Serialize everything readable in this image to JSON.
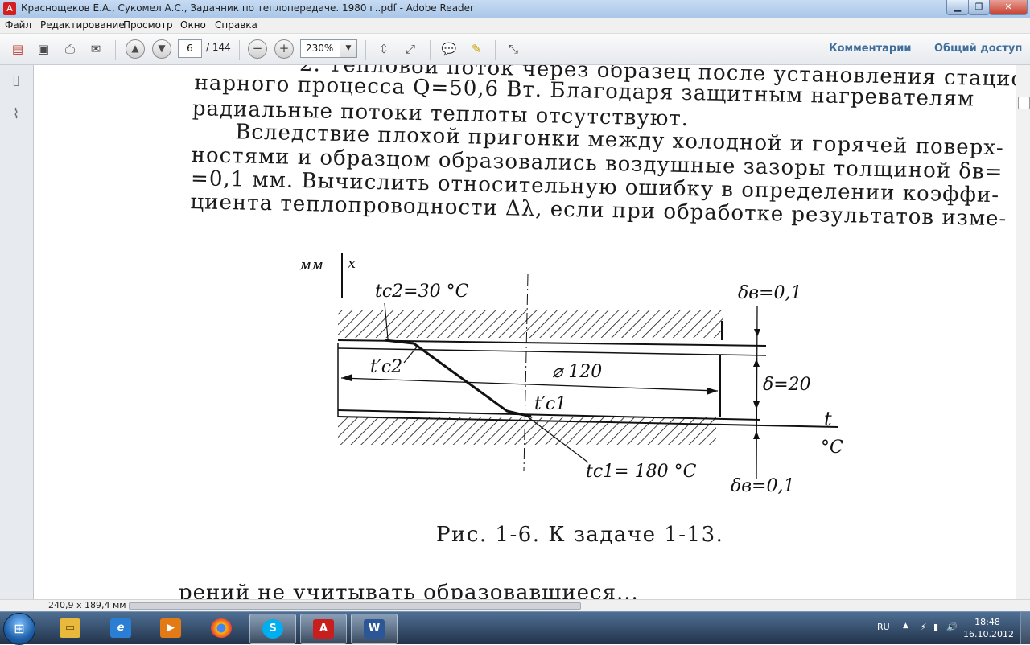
{
  "window": {
    "title": "Краснощеков Е.А., Сукомел А.С., Задачник по теплопередаче. 1980 г..pdf - Adobe Reader"
  },
  "menu": [
    "Файл",
    "Редактирование",
    "Просмотр",
    "Окно",
    "Справка"
  ],
  "toolbar": {
    "page_current": "6",
    "page_total": "/ 144",
    "zoom": "230%",
    "comments": "Комментарии",
    "share": "Общий доступ"
  },
  "document": {
    "lines": [
      "2. Тепловой поток через образец после установления стацио-",
      "нарного процесса Q=50,6 Вт. Благодаря защитным нагревателям",
      "радиальные потоки теплоты отсутствуют.",
      "Вследствие плохой пригонки между холодной и горячей поверх-",
      "ностями и образцом образовались воздушные зазоры толщиной δв=",
      "=0,1 мм. Вычислить относительную ошибку в определении коэффи-",
      "циента теплопроводности Δλ, если при обработке результатов изме-"
    ],
    "figure": {
      "axis_unit": "мм",
      "axis_x": "x",
      "t_c2": "tc2=30 °C",
      "t_c2_prime": "t′c2",
      "t_c1_prime": "t′c1",
      "t_c1": "tc1= 180 °C",
      "diameter": "⌀ 120",
      "delta_b_top": "δв=0,1",
      "delta": "δ=20",
      "delta_b_bottom": "δв=0,1",
      "t_axis": "t",
      "t_unit": "°C"
    },
    "caption": "Рис. 1-6. К задаче 1-13.",
    "bottom_line": "рений не учитывать образовавшиеся..."
  },
  "status": {
    "page_size": "240,9 x 189,4 мм"
  },
  "taskbar": {
    "lang": "RU",
    "time": "18:48",
    "date": "16.10.2012"
  }
}
